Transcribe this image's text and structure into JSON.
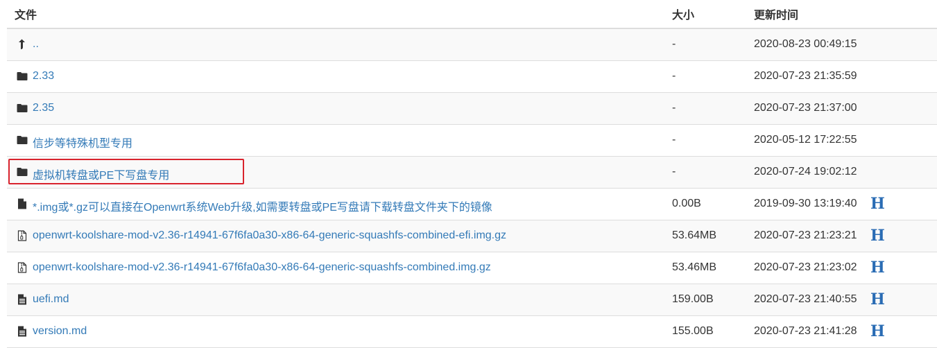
{
  "header": {
    "name_label": "文件",
    "size_label": "大小",
    "time_label": "更新时间"
  },
  "colors": {
    "link": "#337ab7",
    "highlight_border": "#d9232d",
    "hash_icon": "#2a6cb4"
  },
  "rows": [
    {
      "icon": "level-up-icon",
      "name": "..",
      "size": "-",
      "time": "2020-08-23 00:49:15",
      "hash": ""
    },
    {
      "icon": "folder-icon",
      "name": "2.33",
      "size": "-",
      "time": "2020-07-23 21:35:59",
      "hash": ""
    },
    {
      "icon": "folder-icon",
      "name": "2.35",
      "size": "-",
      "time": "2020-07-23 21:37:00",
      "hash": ""
    },
    {
      "icon": "folder-icon",
      "name": "信步等特殊机型专用",
      "size": "-",
      "time": "2020-05-12 17:22:55",
      "hash": ""
    },
    {
      "icon": "folder-icon",
      "name": "虚拟机转盘或PE下写盘专用",
      "size": "-",
      "time": "2020-07-24 19:02:12",
      "hash": "",
      "highlighted": true
    },
    {
      "icon": "file-icon",
      "name": "*.img或*.gz可以直接在Openwrt系统Web升级,如需要转盘或PE写盘请下载转盘文件夹下的镜像",
      "size": "0.00B",
      "time": "2019-09-30 13:19:40",
      "hash": "H"
    },
    {
      "icon": "archive-file-icon",
      "name": "openwrt-koolshare-mod-v2.36-r14941-67f6fa0a30-x86-64-generic-squashfs-combined-efi.img.gz",
      "size": "53.64MB",
      "time": "2020-07-23 21:23:21",
      "hash": "H"
    },
    {
      "icon": "archive-file-icon",
      "name": "openwrt-koolshare-mod-v2.36-r14941-67f6fa0a30-x86-64-generic-squashfs-combined.img.gz",
      "size": "53.46MB",
      "time": "2020-07-23 21:23:02",
      "hash": "H"
    },
    {
      "icon": "text-file-icon",
      "name": "uefi.md",
      "size": "159.00B",
      "time": "2020-07-23 21:40:55",
      "hash": "H"
    },
    {
      "icon": "text-file-icon",
      "name": "version.md",
      "size": "155.00B",
      "time": "2020-07-23 21:41:28",
      "hash": "H"
    }
  ]
}
